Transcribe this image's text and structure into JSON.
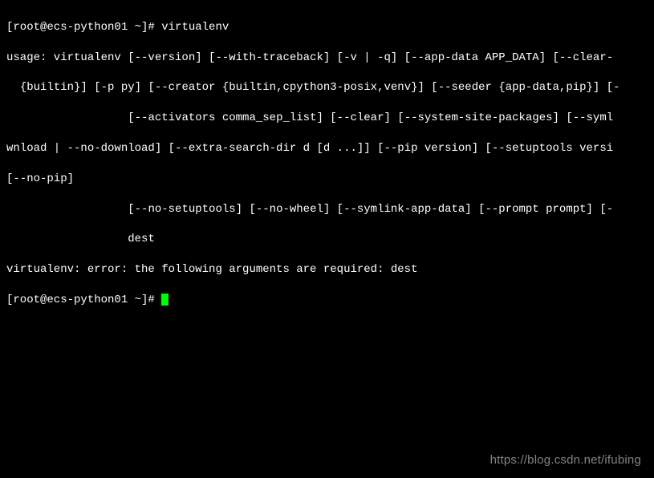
{
  "terminal": {
    "line1_prompt": "[root@ecs-python01 ~]# ",
    "line1_cmd": "virtualenv",
    "line2": "usage: virtualenv [--version] [--with-traceback] [-v | -q] [--app-data APP_DATA] [--clear-",
    "line3": "  {builtin}] [-p py] [--creator {builtin,cpython3-posix,venv}] [--seeder {app-data,pip}] [-",
    "line4": "                  [--activators comma_sep_list] [--clear] [--system-site-packages] [--syml",
    "line5": "wnload | --no-download] [--extra-search-dir d [d ...]] [--pip version] [--setuptools versi",
    "line6": "[--no-pip]",
    "line7": "                  [--no-setuptools] [--no-wheel] [--symlink-app-data] [--prompt prompt] [-",
    "line8": "                  dest",
    "line9": "virtualenv: error: the following arguments are required: dest",
    "line10_prompt": "[root@ecs-python01 ~]# "
  },
  "watermark": "https://blog.csdn.net/ifubing"
}
